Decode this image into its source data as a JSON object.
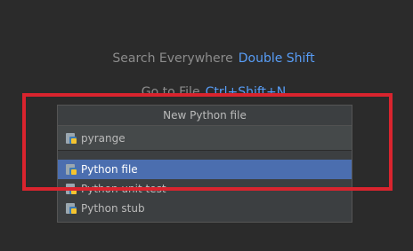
{
  "hints": {
    "search_label": "Search Everywhere",
    "search_key": "Double Shift",
    "goto_label": "Go to File",
    "goto_key": "Ctrl+Shift+N"
  },
  "popup": {
    "title": "New Python file",
    "name_input": {
      "value": "pyrange"
    },
    "items": [
      {
        "label": "Python file",
        "selected": true
      },
      {
        "label": "Python unit test",
        "selected": false
      },
      {
        "label": "Python stub",
        "selected": false
      }
    ]
  },
  "colors": {
    "background": "#2b2b2b",
    "popup_bg": "#3c3f41",
    "selection": "#4b6eaf",
    "shortcut_blue": "#589df6",
    "highlight_red": "#d9242e"
  },
  "icons": {
    "file_type": "python-file-icon"
  }
}
